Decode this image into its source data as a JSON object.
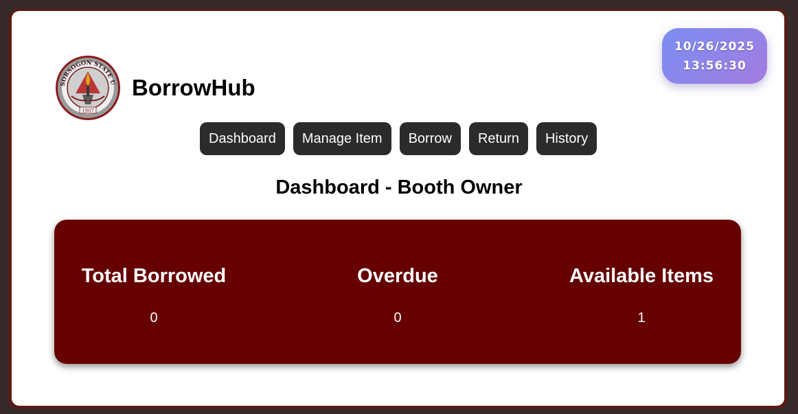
{
  "clock": {
    "date": "10/26/2025",
    "time": "13:56:30"
  },
  "brand": {
    "title": "BorrowHub",
    "logo_icon": "university-seal-icon",
    "logo_text": "SORSOGON STATE UNIVERSITY",
    "logo_year": "1907"
  },
  "nav": {
    "items": [
      {
        "label": "Dashboard"
      },
      {
        "label": "Manage Item"
      },
      {
        "label": "Borrow"
      },
      {
        "label": "Return"
      },
      {
        "label": "History"
      }
    ]
  },
  "page": {
    "title": "Dashboard - Booth Owner"
  },
  "stats": [
    {
      "label": "Total Borrowed",
      "value": "0"
    },
    {
      "label": "Overdue",
      "value": "0"
    },
    {
      "label": "Available Items",
      "value": "1"
    }
  ],
  "colors": {
    "background": "#382a28",
    "frame": "#5c1a12",
    "card": "#ffffff",
    "stats_panel": "#660000",
    "nav_button": "#2b2b2b",
    "clock_gradient_start": "#7b8ef2",
    "clock_gradient_end": "#a37be0"
  }
}
